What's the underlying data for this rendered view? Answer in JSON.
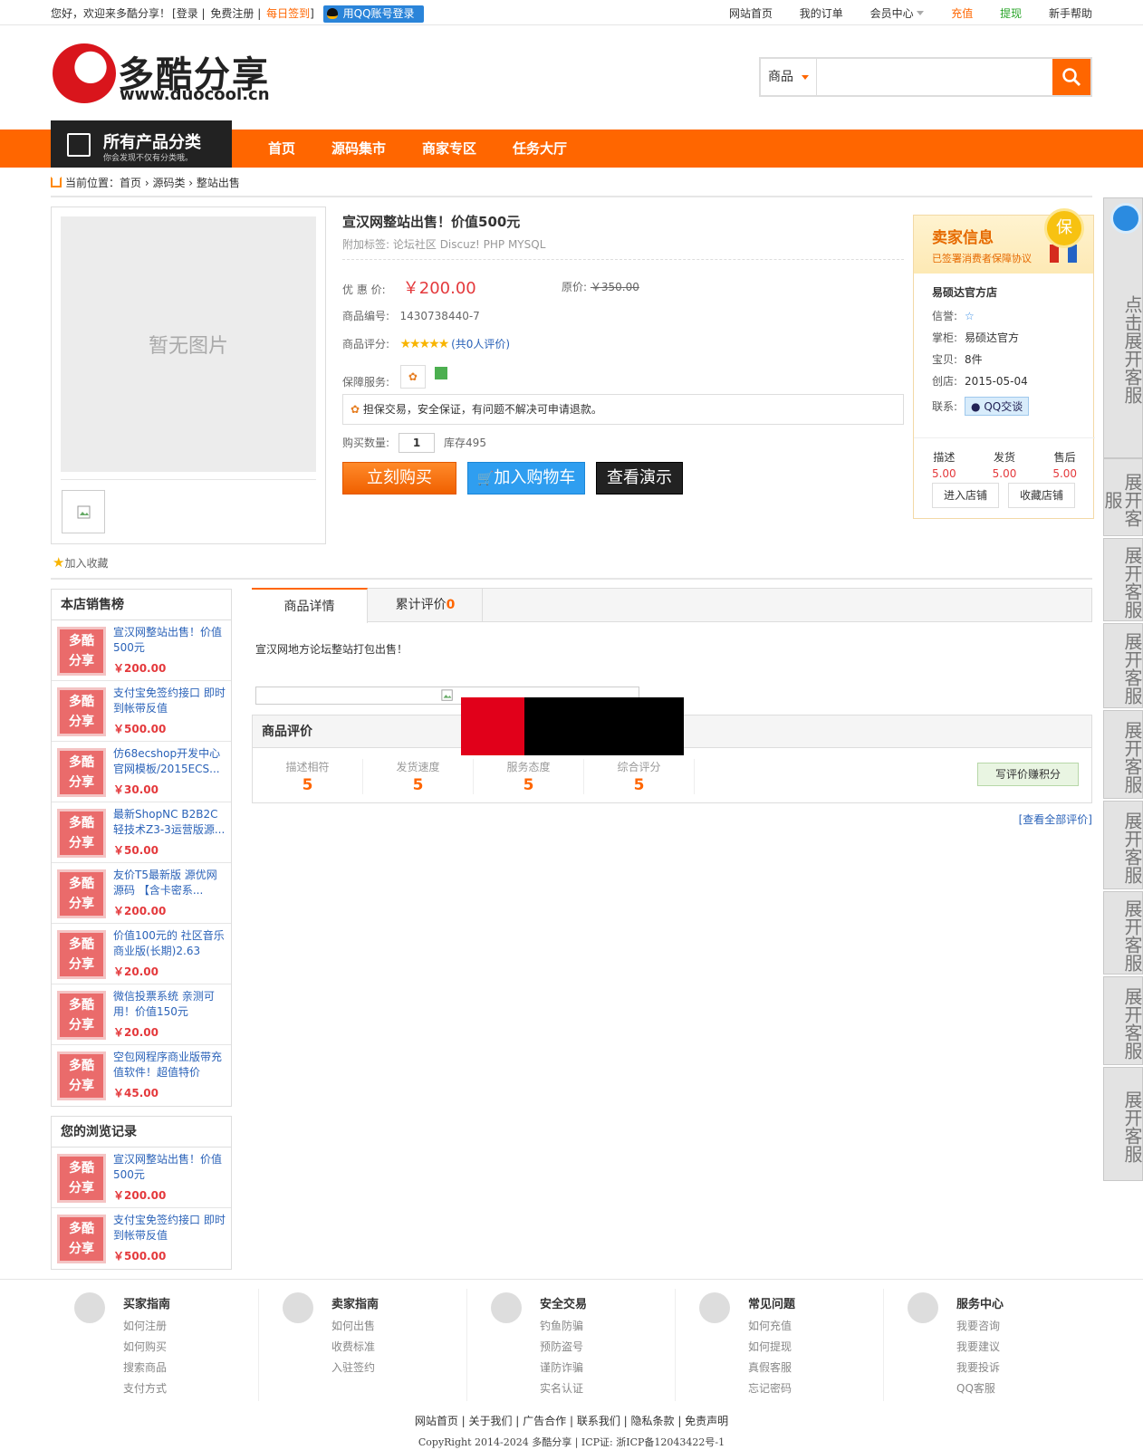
{
  "topbar": {
    "welcome": "您好，欢迎来多酷分享！",
    "login": "[登录",
    "register": "免费注册",
    "signin": "每日签到",
    "close_bracket": "]",
    "qq_login": "用QQ账号登录",
    "links": [
      "网站首页",
      "我的订单",
      "会员中心",
      "充值",
      "提现",
      "新手帮助"
    ]
  },
  "logo": {
    "cn": "多酷分享",
    "en": "www.duocool.cn"
  },
  "search": {
    "category": "商品",
    "placeholder": ""
  },
  "nav": {
    "all_categories": "所有产品分类",
    "all_categories_sub": "你会发现不仅有分类哦。",
    "links": [
      "首页",
      "源码集市",
      "商家专区",
      "任务大厅"
    ]
  },
  "breadcrumb": {
    "prefix": "当前位置：",
    "items": [
      "首页",
      "源码类",
      "整站出售"
    ]
  },
  "product": {
    "no_image": "暂无图片",
    "favorite": "加入收藏",
    "title": "宣汉网整站出售！价值500元",
    "tags_label": "附加标签:",
    "tags": "论坛社区  Discuz!  PHP  MYSQL",
    "price_label": "优 惠 价:",
    "price": "￥200.00",
    "original_label": "原价:",
    "original_price": "￥350.00",
    "code_label": "商品编号:",
    "code": "1430738440-7",
    "rating_label": "商品评分:",
    "rating_count": "(共0人评价)",
    "rating": 5,
    "service_label": "保障服务:",
    "service_text": "担保交易，安全保证，有问题不解决可申请退款。",
    "qty_label": "购买数量:",
    "qty": "1",
    "stock": "库存495",
    "buy_now": "立刻购买",
    "add_cart": "加入购物车",
    "demo": "查看演示"
  },
  "seller": {
    "title": "卖家信息",
    "subtitle": "已签署消费者保障协议",
    "badge": "保",
    "shop": "易硕达官方店",
    "credit_label": "信誉:",
    "owner_label": "掌柜:",
    "owner": "易硕达官方",
    "items_label": "宝贝:",
    "items": "8件",
    "created_label": "创店:",
    "created": "2015-05-04",
    "contact_label": "联系:",
    "qq_chat": "QQ交谈",
    "scores": [
      {
        "label": "描述",
        "value": "5.00"
      },
      {
        "label": "发货",
        "value": "5.00"
      },
      {
        "label": "售后",
        "value": "5.00"
      }
    ],
    "enter_shop": "进入店铺",
    "fav_shop": "收藏店铺"
  },
  "sales_rank": {
    "title": "本店销售榜",
    "logo_text": "多酷分享",
    "items": [
      {
        "name": "宣汉网整站出售！价值500元",
        "price": "￥200.00"
      },
      {
        "name": "支付宝免签约接口 即时到帐带反值",
        "price": "￥500.00"
      },
      {
        "name": "仿68ecshop开发中心官网模板/2015ECS...",
        "price": "￥30.00"
      },
      {
        "name": "最新ShopNC B2B2C 轻技术Z3-3运营版源...",
        "price": "￥50.00"
      },
      {
        "name": "友价T5最新版 源优网源码 【含卡密系...",
        "price": "￥200.00"
      },
      {
        "name": "价值100元的 社区音乐商业版(长期)2.63",
        "price": "￥20.00"
      },
      {
        "name": "微信投票系统 亲测可用！价值150元",
        "price": "￥20.00"
      },
      {
        "name": "空包网程序商业版带充值软件！超值特价",
        "price": "￥45.00"
      }
    ]
  },
  "history": {
    "title": "您的浏览记录",
    "items": [
      {
        "name": "宣汉网整站出售！价值500元",
        "price": "￥200.00"
      },
      {
        "name": "支付宝免签约接口 即时到帐带反值",
        "price": "￥500.00"
      }
    ]
  },
  "tabs": {
    "detail": "商品详情",
    "reviews": "累计评价",
    "reviews_count": "0"
  },
  "detail_text": "宣汉网地方论坛整站打包出售！",
  "review": {
    "title": "商品评价",
    "cols": [
      {
        "label": "描述相符",
        "value": "5"
      },
      {
        "label": "发货速度",
        "value": "5"
      },
      {
        "label": "服务态度",
        "value": "5"
      },
      {
        "label": "综合评分",
        "value": "5"
      }
    ],
    "write": "写评价赚积分",
    "view_all": "[查看全部评价]"
  },
  "kefu": {
    "first": "点击展开客服",
    "repeat": "展开客服"
  },
  "footer": {
    "cols": [
      {
        "title": "买家指南",
        "items": [
          "如何注册",
          "如何购买",
          "搜索商品",
          "支付方式"
        ]
      },
      {
        "title": "卖家指南",
        "items": [
          "如何出售",
          "收费标准",
          "入驻签约"
        ]
      },
      {
        "title": "安全交易",
        "items": [
          "钓鱼防骗",
          "预防盗号",
          "谨防诈骗",
          "实名认证"
        ]
      },
      {
        "title": "常见问题",
        "items": [
          "如何充值",
          "如何提现",
          "真假客服",
          "忘记密码"
        ]
      },
      {
        "title": "服务中心",
        "items": [
          "我要咨询",
          "我要建议",
          "我要投诉",
          "QQ客服"
        ]
      }
    ],
    "links": "网站首页 | 关于我们 | 广告合作 | 联系我们 | 隐私条款 | 免责声明",
    "copyright": "CopyRight 2014-2024 多酷分享 | ICP证: 浙ICP备12043422号-1"
  }
}
